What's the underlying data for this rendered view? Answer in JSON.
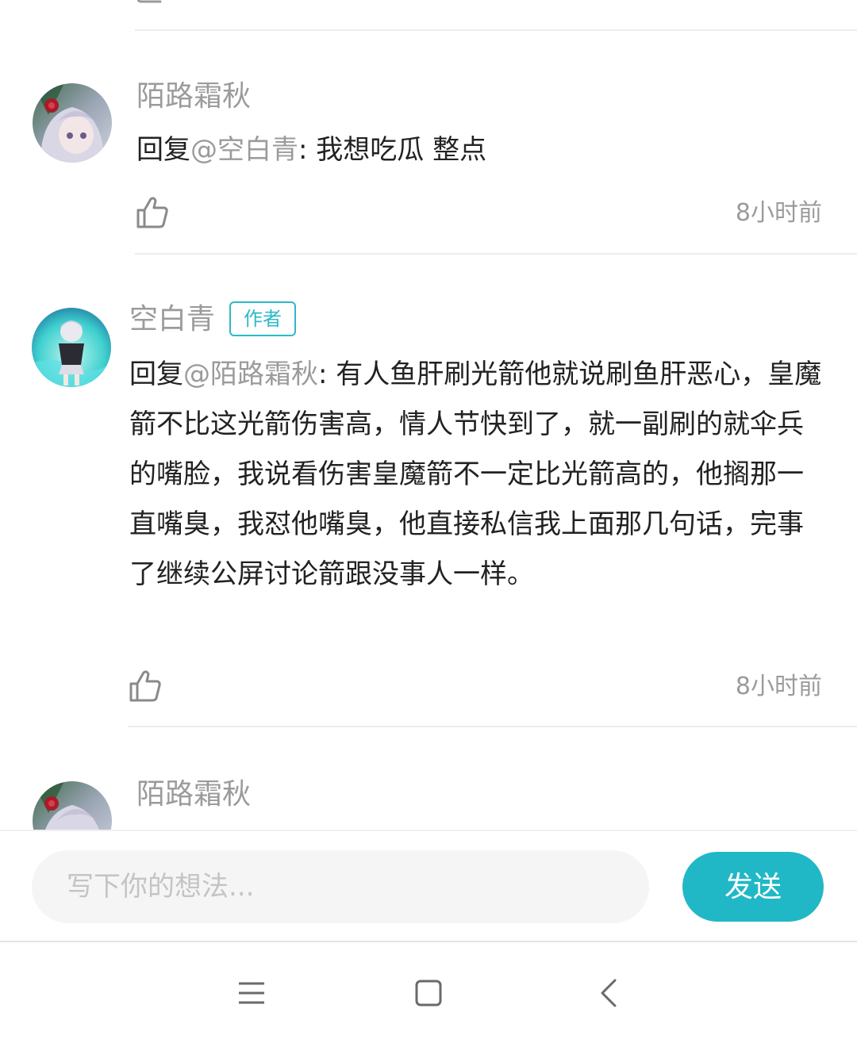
{
  "comments": [
    {
      "username": "陌路霜秋",
      "reply_prefix": "回复",
      "mention": "@空白青",
      "separator": ": ",
      "text": "我想吃瓜 整点",
      "time": "8小时前"
    },
    {
      "username": "空白青",
      "badge": "作者",
      "reply_prefix": "回复",
      "mention": "@陌路霜秋",
      "separator": ": ",
      "text": "有人鱼肝刷光箭他就说刷鱼肝恶心，皇魔箭不比这光箭伤害高，情人节快到了，就一副刷的就伞兵的嘴脸，我说看伤害皇魔箭不一定比光箭高的，他搁那一直嘴臭，我怼他嘴臭，他直接私信我上面那几句话，完事了继续公屏讨论箭跟没事人一样。",
      "time": "8小时前"
    },
    {
      "username": "陌路霜秋"
    }
  ],
  "composer": {
    "placeholder": "写下你的想法...",
    "send_label": "发送"
  },
  "colors": {
    "accent": "#20b8c6",
    "badge": "#2cb9c8",
    "muted_text": "#9b9b9b",
    "body_text": "#222222"
  },
  "icons": {
    "like": "thumbs-up-icon",
    "nav_menu": "menu-icon",
    "nav_home": "home-square-icon",
    "nav_back": "back-chevron-icon"
  }
}
